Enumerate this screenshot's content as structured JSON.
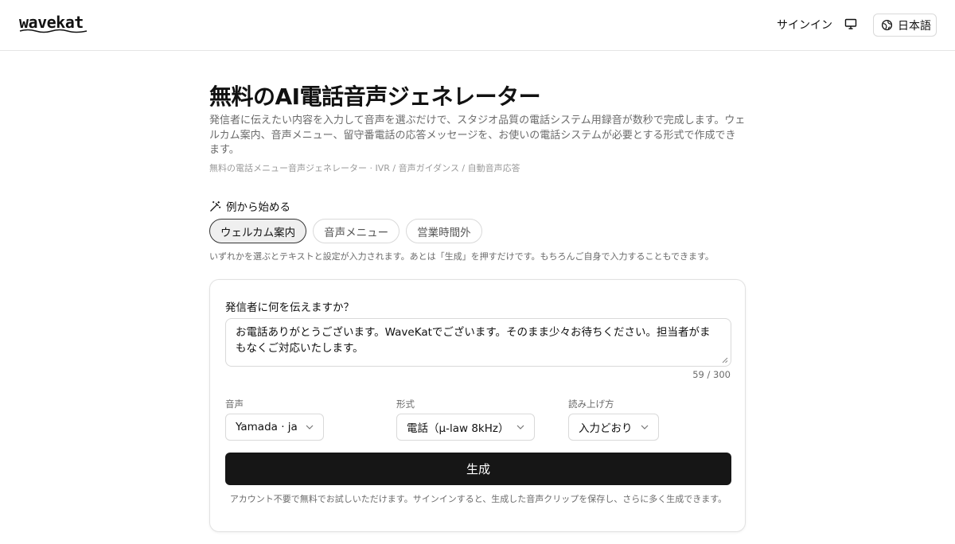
{
  "header": {
    "logo_text": "wavekat",
    "signin_label": "サインイン",
    "display_icon": "monitor-icon",
    "language_label": "日本語",
    "language_icon": "globe-icon"
  },
  "hero": {
    "title": "無料のAI電話音声ジェネレーター",
    "description": "発信者に伝えたい内容を入力して音声を選ぶだけで、スタジオ品質の電話システム用録音が数秒で完成します。ウェルカム案内、音声メニュー、留守番電話の応答メッセージを、お使いの電話システムが必要とする形式で作成できます。",
    "subdescription": "無料の電話メニュー音声ジェネレーター · IVR / 音声ガイダンス / 自動音声応答"
  },
  "examples": {
    "label": "例から始める",
    "icon": "magic-wand-icon",
    "chips": [
      {
        "label": "ウェルカム案内",
        "active": true
      },
      {
        "label": "音声メニュー",
        "active": false
      },
      {
        "label": "営業時間外",
        "active": false
      }
    ],
    "hint": "いずれかを選ぶとテキストと設定が入力されます。あとは「生成」を押すだけです。もちろんご自身で入力することもできます。"
  },
  "form": {
    "message_label": "発信者に何を伝えますか？",
    "message_value": "お電話ありがとうございます。WaveKatでございます。そのまま少々お待ちください。担当者がまもなくご対応いたします。",
    "counter": "59 / 300",
    "voice": {
      "label": "音声",
      "value": "Yamada · ja"
    },
    "format": {
      "label": "形式",
      "value": "電話（μ-law 8kHz）"
    },
    "reading": {
      "label": "読み上げ方",
      "value": "入力どおり"
    },
    "generate_label": "生成",
    "footnote": "アカウント不要で無料でお試しいただけます。サインインすると、生成した音声クリップを保存し、さらに多く生成できます。"
  },
  "colors": {
    "primary_button": "#161616",
    "chip_active_bg": "#efefef",
    "border": "#d9d9d9",
    "muted_text": "#6b6b6b"
  }
}
